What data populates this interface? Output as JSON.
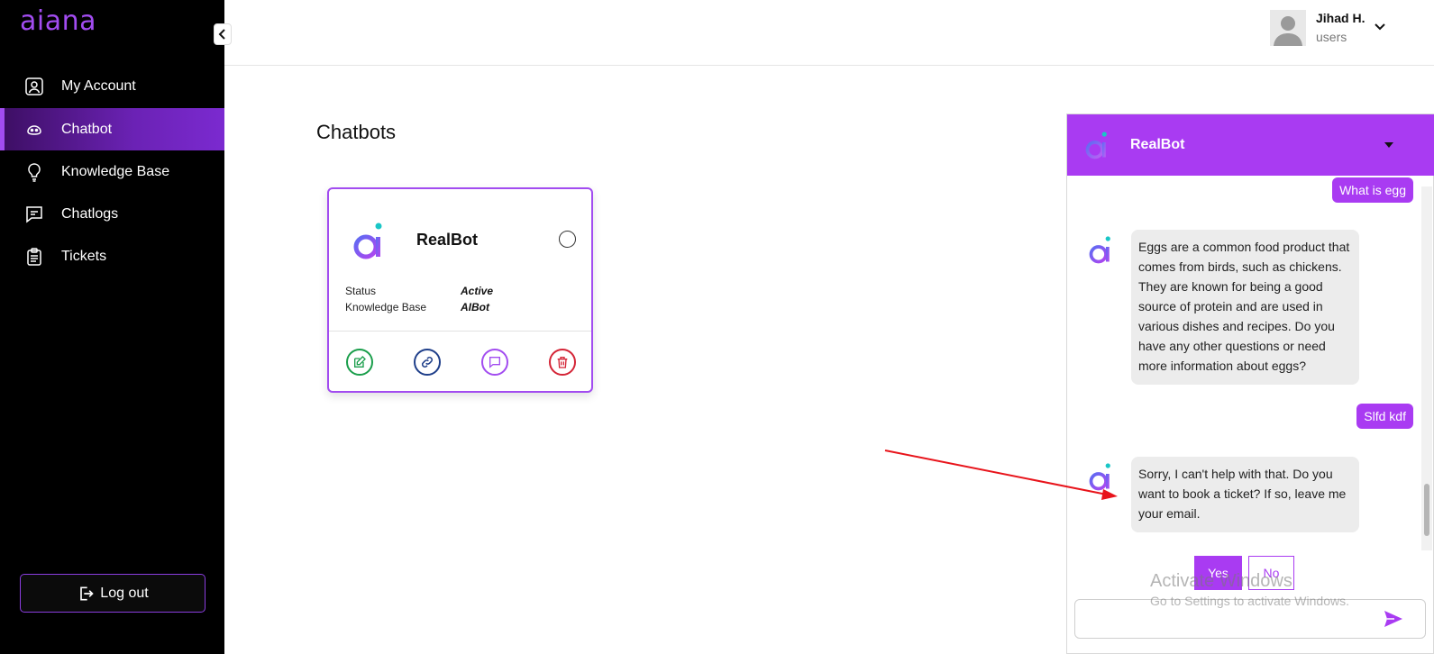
{
  "sidebar": {
    "logo": "aiana",
    "items": [
      {
        "label": "My Account",
        "icon": "user-square-icon",
        "active": false
      },
      {
        "label": "Chatbot",
        "icon": "bot-icon",
        "active": true
      },
      {
        "label": "Knowledge Base",
        "icon": "lightbulb-icon",
        "active": false
      },
      {
        "label": "Chatlogs",
        "icon": "message-square-icon",
        "active": false
      },
      {
        "label": "Tickets",
        "icon": "clipboard-icon",
        "active": false
      }
    ],
    "logout_label": "Log out"
  },
  "header": {
    "user_name": "Jihad H.",
    "user_role": "users"
  },
  "main": {
    "title": "Chatbots",
    "card": {
      "name": "RealBot",
      "status_label": "Status",
      "status_value": "Active",
      "kb_label": "Knowledge Base",
      "kb_value": "AIBot"
    }
  },
  "chat": {
    "title": "RealBot",
    "messages": [
      {
        "from": "user",
        "text": "What is egg"
      },
      {
        "from": "bot",
        "text": "Eggs are a common food product that comes from birds, such as chickens. They are known for being a good source of protein and are used in various dishes and recipes. Do you have any other questions or need more information about eggs?"
      },
      {
        "from": "user",
        "text": "Slfd kdf"
      },
      {
        "from": "bot",
        "text": "Sorry, I can't help with that. Do you want to book a ticket? If so, leave me your email."
      }
    ],
    "yes_label": "Yes",
    "no_label": "No",
    "input_value": ""
  },
  "watermark": {
    "title": "Activate Windows",
    "subtitle": "Go to Settings to activate Windows."
  },
  "colors": {
    "accent": "#a93bf2",
    "sidebar_bg": "#000000",
    "edit": "#1a9e4b",
    "link": "#1f3f8a",
    "chat": "#a24cf0",
    "delete": "#d42436",
    "annotation_arrow": "#e8141b"
  }
}
